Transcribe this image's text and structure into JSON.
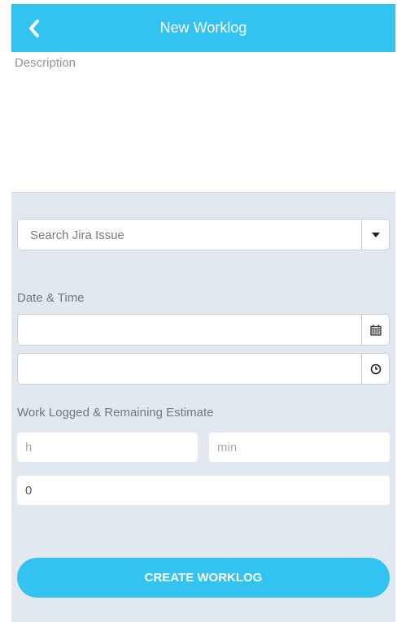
{
  "header": {
    "title": "New Worklog",
    "back_icon": "chevron-left-icon"
  },
  "description": {
    "placeholder": "Description"
  },
  "issue_search": {
    "placeholder": "Search Jira Issue",
    "dropdown_icon": "caret-down-icon"
  },
  "datetime": {
    "label": "Date & Time",
    "date_value": "",
    "time_value": "",
    "date_icon": "calendar-icon",
    "time_icon": "clock-icon"
  },
  "work": {
    "label": "Work Logged & Remaining Estimate",
    "hours_placeholder": "h",
    "minutes_placeholder": "min",
    "remaining_value": "0"
  },
  "actions": {
    "create_label": "CREATE WORKLOG"
  },
  "colors": {
    "accent": "#33c3f1",
    "form_bg": "#e1e8ef"
  }
}
